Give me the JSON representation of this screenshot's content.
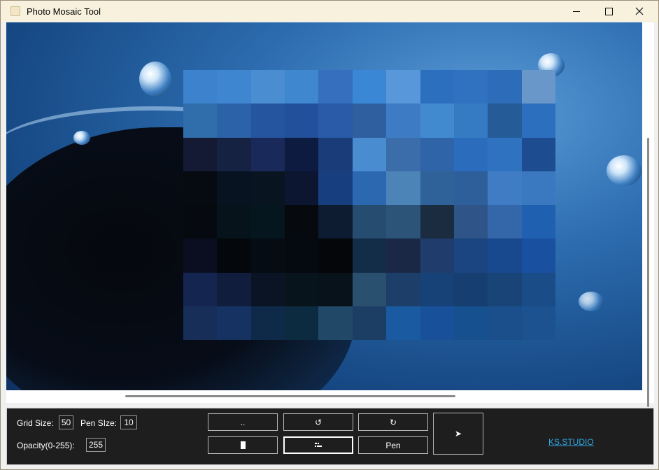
{
  "window": {
    "title": "Photo Mosaic Tool"
  },
  "controls": {
    "grid_size_label": "Grid Size:",
    "grid_size_value": "50",
    "pen_size_label": "Pen SIze:",
    "pen_size_value": "10",
    "opacity_label": "Opacity(0-255):",
    "opacity_value": "255"
  },
  "toolbar": {
    "open_label": "..",
    "undo_label": "↺",
    "redo_label": "↻",
    "pen_label": "Pen",
    "send_label": "➤"
  },
  "footer": {
    "link_text": "KS.STUDIO"
  },
  "colors": {
    "panel_bg": "#1e1e1e",
    "link": "#2fa8e6",
    "titlebar_bg": "#f7f1dd"
  },
  "mosaic_colors": [
    [
      "#3c82cc",
      "#3f86d0",
      "#4a8dd0",
      "#3f87cf",
      "#356fbe",
      "#3a87d6",
      "#5898da",
      "#2d6fbf",
      "#3172c0",
      "#2c6cb8",
      "#6a97c9"
    ],
    [
      "#2f6dab",
      "#2c62a8",
      "#2655a0",
      "#23509a",
      "#2a5ba8",
      "#2f5f9e",
      "#3d7cc4",
      "#428ad0",
      "#347bc4",
      "#255c98",
      "#2d6fbf"
    ],
    [
      "#141a33",
      "#152242",
      "#192a5a",
      "#0e1b40",
      "#1a3c78",
      "#4a8cd0",
      "#3a6daa",
      "#2f65a8",
      "#2c6cbc",
      "#2e72c0",
      "#1e4c90"
    ],
    [
      "#060b12",
      "#071320",
      "#081520",
      "#0d1630",
      "#173f80",
      "#2c68b0",
      "#4c84b8",
      "#2f6299",
      "#2e5f9a",
      "#3f7cc4",
      "#3a78c0"
    ],
    [
      "#06090f",
      "#06131b",
      "#05161f",
      "#06090e",
      "#0d1c30",
      "#264d70",
      "#2c5478",
      "#1c2c40",
      "#2e5488",
      "#3466aa",
      "#2060b0"
    ],
    [
      "#0a0e20",
      "#04070c",
      "#050c14",
      "#050a10",
      "#04060a",
      "#132c48",
      "#1a2846",
      "#203c6c",
      "#1b4580",
      "#18498e",
      "#1a50a0"
    ],
    [
      "#142650",
      "#101d3c",
      "#0a1424",
      "#08141c",
      "#08121a",
      "#2a5070",
      "#1c3e68",
      "#174278",
      "#163e70",
      "#184478",
      "#1a4c88"
    ],
    [
      "#172e58",
      "#163262",
      "#0e2a48",
      "#0c2a40",
      "#224868",
      "#1d3e64",
      "#1a5aa0",
      "#18509a",
      "#17508e",
      "#1a4f8c",
      "#1c5290"
    ]
  ]
}
